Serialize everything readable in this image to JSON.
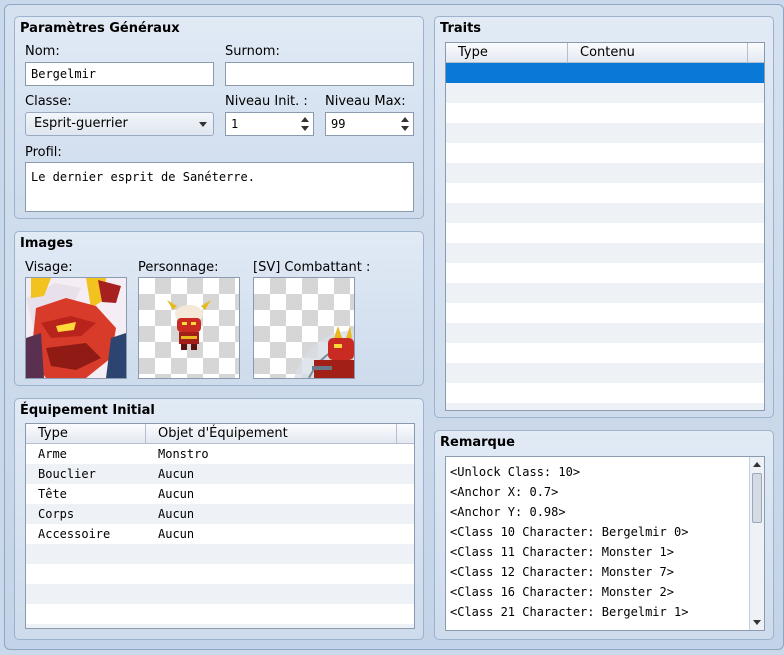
{
  "general": {
    "title": "Paramètres Généraux",
    "name_label": "Nom:",
    "name_value": "Bergelmir",
    "nickname_label": "Surnom:",
    "nickname_value": "",
    "class_label": "Classe:",
    "class_value": "Esprit-guerrier",
    "init_level_label": "Niveau Init. :",
    "init_level_value": "1",
    "max_level_label": "Niveau Max:",
    "max_level_value": "99",
    "profile_label": "Profil:",
    "profile_value": "Le dernier esprit de Sanéterre."
  },
  "images": {
    "title": "Images",
    "face_label": "Visage:",
    "character_label": "Personnage:",
    "battler_label": "[SV] Combattant :"
  },
  "equipment": {
    "title": "Équipement Initial",
    "col_type": "Type",
    "col_item": "Objet d'Équipement",
    "rows": [
      {
        "type": "Arme",
        "item": "Monstro"
      },
      {
        "type": "Bouclier",
        "item": "Aucun"
      },
      {
        "type": "Tête",
        "item": "Aucun"
      },
      {
        "type": "Corps",
        "item": "Aucun"
      },
      {
        "type": "Accessoire",
        "item": "Aucun"
      }
    ]
  },
  "traits": {
    "title": "Traits",
    "col_type": "Type",
    "col_content": "Contenu",
    "selection_color": "#0a78d7"
  },
  "note": {
    "title": "Remarque",
    "lines": [
      "<Unlock Class: 10>",
      "<Anchor X: 0.7>",
      "<Anchor Y: 0.98>",
      "<Class 10 Character: Bergelmir 0>",
      "<Class 11 Character: Monster 1>",
      "<Class 12 Character: Monster 7>",
      "<Class 16 Character: Monster 2>",
      "<Class 21 Character: Bergelmir 1>"
    ]
  }
}
